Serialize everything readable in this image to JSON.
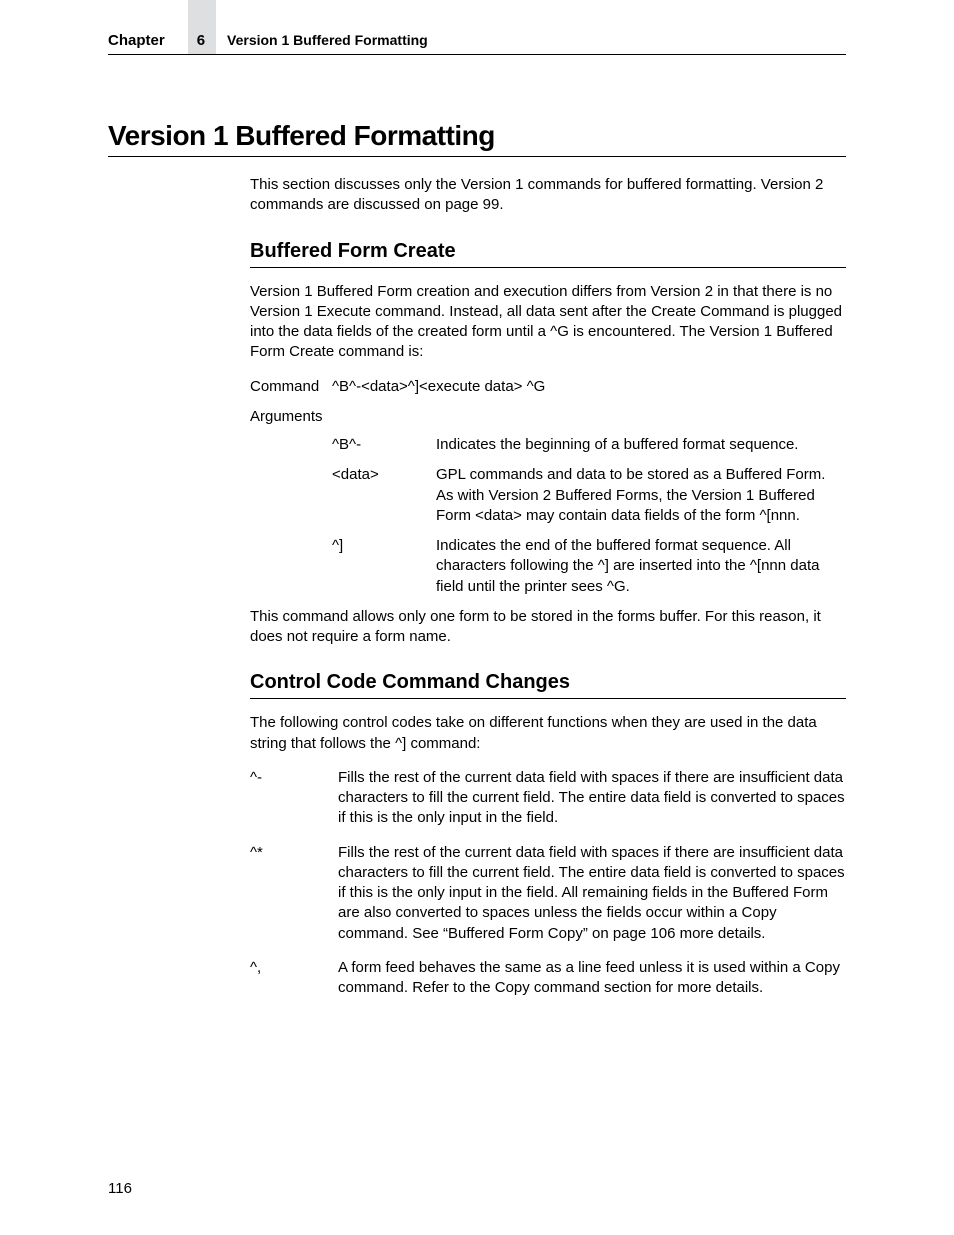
{
  "header": {
    "chapter_word": "Chapter",
    "chapter_num": "6",
    "chapter_title": "Version 1 Buffered Formatting"
  },
  "title": "Version 1 Buffered Formatting",
  "intro": "This section discusses only the Version 1 commands for buffered formatting. Version 2 commands are discussed on page 99.",
  "section1": {
    "title": "Buffered Form Create",
    "para": "Version 1 Buffered Form creation and execution differs from Version 2 in that there is no Version 1 Execute command. Instead, all data sent after the Create Command is plugged into the data fields of the created form until a ^G is encountered. The Version 1 Buffered Form Create command is:",
    "command_label": "Command",
    "command_value": "^B^-<data>^]<execute data> ^G",
    "arguments_label": "Arguments",
    "args": [
      {
        "term": "^B^-",
        "desc": "Indicates the beginning of a buffered format sequence."
      },
      {
        "term": "<data>",
        "desc": "GPL commands and data to be stored as a Buffered Form. As with Version 2 Buffered Forms, the Version 1 Buffered Form <data> may contain data fields of the form ^[nnn."
      },
      {
        "term": "^]",
        "desc": "Indicates the end of the buffered format sequence. All characters following the ^] are inserted into the ^[nnn data field until the printer sees ^G."
      }
    ],
    "note": "This command allows only one form to be stored in the forms buffer. For this reason, it does not require a form name."
  },
  "section2": {
    "title": "Control Code Command Changes",
    "para": "The following control codes take on different functions when they are used in the data string that follows the ^] command:",
    "codes": [
      {
        "term": "^-",
        "desc": "Fills the rest of the current data field with spaces if there are insufficient data characters to fill the current field. The entire data field is converted to spaces if this is the only input in the field."
      },
      {
        "term": "^*",
        "desc": "Fills the rest of the current data field with spaces if there are insufficient data characters to fill the current field. The entire data field is converted to spaces if this is the only input in the field. All remaining fields in the Buffered Form are also converted to spaces unless the fields occur within a Copy command. See “Buffered Form Copy” on page 106 more details."
      },
      {
        "term": "^,",
        "desc": "A form feed behaves the same as a line feed unless it is used within a Copy command. Refer to the Copy command section for more details."
      }
    ]
  },
  "page_number": "116"
}
